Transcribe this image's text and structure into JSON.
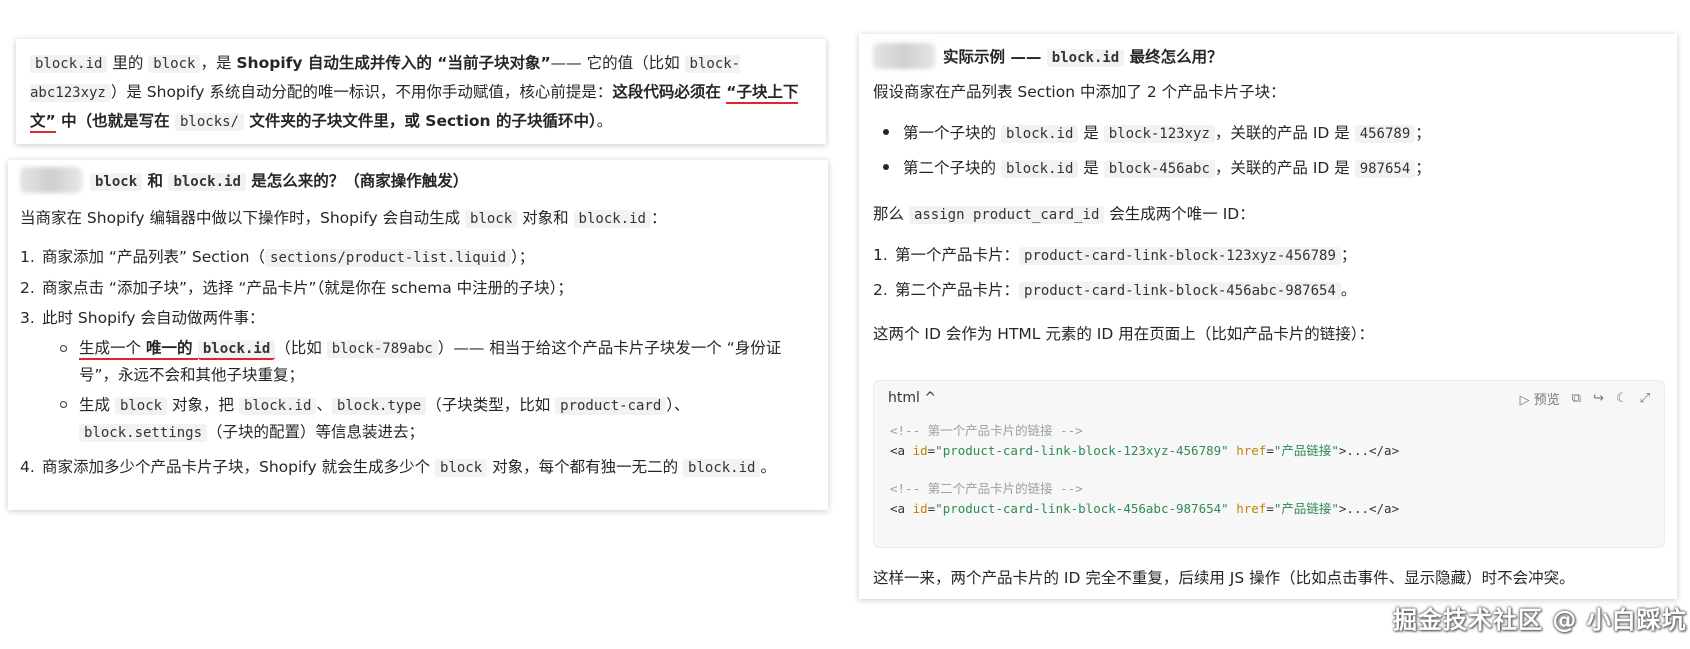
{
  "card1": {
    "p": [
      {
        "t": "code",
        "v": "block.id"
      },
      {
        "t": "text",
        "v": " 里的 "
      },
      {
        "t": "code",
        "v": "block"
      },
      {
        "t": "text",
        "v": "，是 "
      },
      {
        "t": "bold",
        "v": "Shopify 自动生成并传入的 “当前子块对象”"
      },
      {
        "t": "text",
        "v": "—— 它的值（比如 "
      },
      {
        "t": "code",
        "v": "block-abc123xyz"
      },
      {
        "t": "text",
        "v": "）是 Shopify 系统自动分配的唯一标识，不用你手动赋值，核心前提是："
      },
      {
        "t": "bold",
        "v": "这段代码必须在 "
      },
      {
        "t": "boldred",
        "v": "“子块上下文”"
      },
      {
        "t": "bold",
        "v": " 中（也就是写在 "
      },
      {
        "t": "code",
        "v": "blocks/"
      },
      {
        "t": "bold",
        "v": " 文件夹的子块文件里，或 Section 的子块循环中）"
      },
      {
        "t": "text",
        "v": "。"
      }
    ]
  },
  "card2": {
    "heading": [
      {
        "t": "code",
        "v": "block"
      },
      {
        "t": "bold",
        "v": " 和 "
      },
      {
        "t": "code",
        "v": "block.id"
      },
      {
        "t": "bold",
        "v": " 是怎么来的？（商家操作触发）"
      }
    ],
    "intro": [
      {
        "t": "text",
        "v": "当商家在 Shopify 编辑器中做以下操作时，Shopify 会自动生成 "
      },
      {
        "t": "code",
        "v": "block"
      },
      {
        "t": "text",
        "v": " 对象和 "
      },
      {
        "t": "code",
        "v": "block.id"
      },
      {
        "t": "text",
        "v": "："
      }
    ],
    "steps": [
      {
        "n": "1.",
        "parts": [
          {
            "t": "text",
            "v": "商家添加 “产品列表” Section（"
          },
          {
            "t": "code",
            "v": "sections/product-list.liquid"
          },
          {
            "t": "text",
            "v": "）；"
          }
        ]
      },
      {
        "n": "2.",
        "parts": [
          {
            "t": "text",
            "v": "商家点击 “添加子块”，选择 “产品卡片”（就是你在 schema 中注册的子块）；"
          }
        ]
      },
      {
        "n": "3.",
        "parts": [
          {
            "t": "text",
            "v": "此时 Shopify 会自动做两件事："
          }
        ]
      }
    ],
    "sub": [
      {
        "parts": [
          {
            "t": "ul",
            "v": "生成一个 "
          },
          {
            "t": "ulbold",
            "v": "唯一的 "
          },
          {
            "t": "ulboldcode",
            "v": "block.id"
          },
          {
            "t": "text",
            "v": "（比如 "
          },
          {
            "t": "code",
            "v": "block-789abc"
          },
          {
            "t": "text",
            "v": "）—— 相当于给这个产品卡片子块发一个 “身份证号”，永远不会和其他子块重复；"
          }
        ]
      },
      {
        "parts": [
          {
            "t": "text",
            "v": "生成 "
          },
          {
            "t": "code",
            "v": "block"
          },
          {
            "t": "text",
            "v": " 对象，把 "
          },
          {
            "t": "code",
            "v": "block.id"
          },
          {
            "t": "text",
            "v": "、"
          },
          {
            "t": "code",
            "v": "block.type"
          },
          {
            "t": "text",
            "v": "（子块类型，比如 "
          },
          {
            "t": "code",
            "v": "product-card"
          },
          {
            "t": "text",
            "v": "）、"
          },
          {
            "t": "code",
            "v": "block.settings"
          },
          {
            "t": "text",
            "v": "（子块的配置）等信息装进去；"
          }
        ]
      }
    ],
    "step4": {
      "n": "4.",
      "parts": [
        {
          "t": "text",
          "v": "商家添加多少个产品卡片子块，Shopify 就会生成多少个 "
        },
        {
          "t": "code",
          "v": "block"
        },
        {
          "t": "text",
          "v": " 对象，每个都有独一无二的 "
        },
        {
          "t": "code",
          "v": "block.id"
        },
        {
          "t": "text",
          "v": "。"
        }
      ]
    }
  },
  "card3": {
    "heading": [
      {
        "t": "bold",
        "v": "实际示例 —— "
      },
      {
        "t": "code",
        "v": "block.id"
      },
      {
        "t": "bold",
        "v": " 最终怎么用？"
      }
    ],
    "intro": "假设商家在产品列表 Section 中添加了 2 个产品卡片子块：",
    "bullets": [
      [
        {
          "t": "text",
          "v": "第一个子块的 "
        },
        {
          "t": "code",
          "v": "block.id"
        },
        {
          "t": "text",
          "v": " 是 "
        },
        {
          "t": "code",
          "v": "block-123xyz"
        },
        {
          "t": "text",
          "v": "，关联的产品 ID 是 "
        },
        {
          "t": "code",
          "v": "456789"
        },
        {
          "t": "text",
          "v": "；"
        }
      ],
      [
        {
          "t": "text",
          "v": "第二个子块的 "
        },
        {
          "t": "code",
          "v": "block.id"
        },
        {
          "t": "text",
          "v": " 是 "
        },
        {
          "t": "code",
          "v": "block-456abc"
        },
        {
          "t": "text",
          "v": "，关联的产品 ID 是 "
        },
        {
          "t": "code",
          "v": "987654"
        },
        {
          "t": "text",
          "v": "；"
        }
      ]
    ],
    "then": [
      {
        "t": "text",
        "v": "那么 "
      },
      {
        "t": "code",
        "v": "assign product_card_id"
      },
      {
        "t": "text",
        "v": " 会生成两个唯一 ID："
      }
    ],
    "ids": [
      {
        "n": "1.",
        "parts": [
          {
            "t": "text",
            "v": "第一个产品卡片："
          },
          {
            "t": "code",
            "v": "product-card-link-block-123xyz-456789"
          },
          {
            "t": "text",
            "v": "；"
          }
        ]
      },
      {
        "n": "2.",
        "parts": [
          {
            "t": "text",
            "v": "第二个产品卡片："
          },
          {
            "t": "code",
            "v": "product-card-link-block-456abc-987654"
          },
          {
            "t": "text",
            "v": "。"
          }
        ]
      }
    ],
    "usage": "这两个 ID 会作为 HTML 元素的 ID 用在页面上（比如产品卡片的链接）：",
    "codeblock": {
      "lang": "html ^",
      "preview_label": "预览",
      "comment1": "<!-- 第一个产品卡片的链接 -->",
      "line1": {
        "open": "<a ",
        "id_attr": "id",
        "id_val": "\"product-card-link-block-123xyz-456789\"",
        "href_attr": "href",
        "href_val": "\"产品链接\"",
        "close": ">...</a>"
      },
      "comment2": "<!-- 第二个产品卡片的链接 -->",
      "line2": {
        "open": "<a ",
        "id_attr": "id",
        "id_val": "\"product-card-link-block-456abc-987654\"",
        "href_attr": "href",
        "href_val": "\"产品链接\"",
        "close": ">...</a>"
      }
    },
    "conclusion": "这样一来，两个产品卡片的 ID 完全不重复，后续用 JS 操作（比如点击事件、显示隐藏）时不会冲突。"
  },
  "watermark": "掘金技术社区 @ 小白踩坑"
}
